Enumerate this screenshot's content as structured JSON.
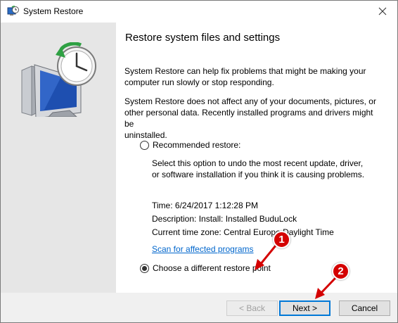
{
  "window": {
    "title": "System Restore",
    "icons": {
      "app": "system-restore-icon",
      "close": "close-icon"
    }
  },
  "content": {
    "heading": "Restore system files and settings",
    "paragraph1_line1": "System Restore can help fix problems that might be making your",
    "paragraph1_line2": "computer run slowly or stop responding.",
    "paragraph2_line1": "System Restore does not affect any of your documents, pictures, or",
    "paragraph2_line2": "other personal data. Recently installed programs and drivers might be",
    "paragraph2_line3": "uninstalled.",
    "recommended_label": "Recommended restore:",
    "recommended_checked": false,
    "recommended_desc_line1": "Select this option to undo the most recent update, driver,",
    "recommended_desc_line2": "or software installation if you think it is causing problems.",
    "time": "Time: 6/24/2017 1:12:28 PM",
    "description": "Description: Install: Installed BuduLock",
    "timezone": "Current time zone: Central Europe Daylight Time",
    "scan_link": "Scan for affected programs",
    "different_label": "Choose a different restore point",
    "different_checked": true
  },
  "footer": {
    "back_label": "< Back",
    "next_label": "Next >",
    "cancel_label": "Cancel"
  },
  "annotations": {
    "badge1": "1",
    "badge2": "2",
    "color": "#d40000"
  }
}
